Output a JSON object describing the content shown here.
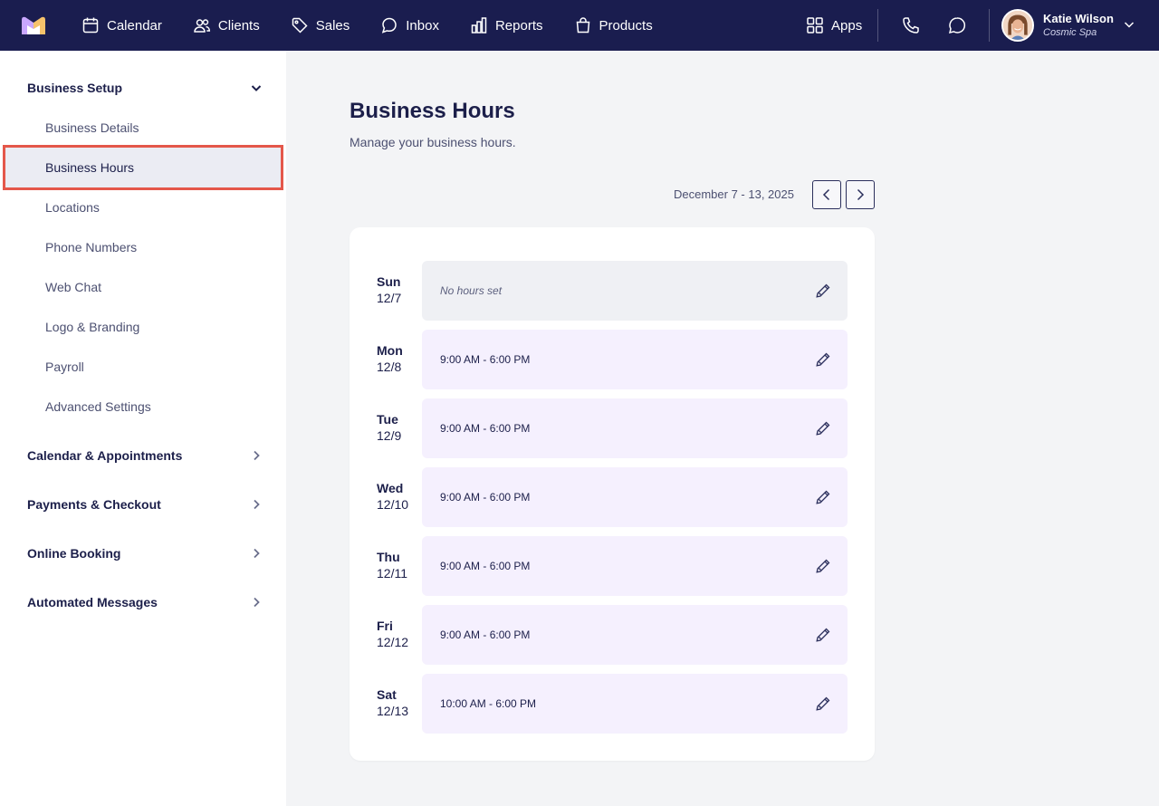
{
  "nav": {
    "items": [
      {
        "label": "Calendar",
        "icon": "calendar-icon"
      },
      {
        "label": "Clients",
        "icon": "clients-icon"
      },
      {
        "label": "Sales",
        "icon": "tag-icon"
      },
      {
        "label": "Inbox",
        "icon": "inbox-icon"
      },
      {
        "label": "Reports",
        "icon": "bar-chart-icon"
      },
      {
        "label": "Products",
        "icon": "shopping-bag-icon"
      }
    ],
    "apps_label": "Apps",
    "user": {
      "name": "Katie Wilson",
      "org": "Cosmic Spa"
    }
  },
  "sidebar": {
    "sections": [
      {
        "label": "Business Setup",
        "expanded": true
      },
      {
        "label": "Calendar & Appointments",
        "expanded": false
      },
      {
        "label": "Payments & Checkout",
        "expanded": false
      },
      {
        "label": "Online Booking",
        "expanded": false
      },
      {
        "label": "Automated Messages",
        "expanded": false
      }
    ],
    "items": [
      {
        "label": "Business Details"
      },
      {
        "label": "Business Hours",
        "active": true
      },
      {
        "label": "Locations"
      },
      {
        "label": "Phone Numbers"
      },
      {
        "label": "Web Chat"
      },
      {
        "label": "Logo & Branding"
      },
      {
        "label": "Payroll"
      },
      {
        "label": "Advanced Settings"
      }
    ]
  },
  "page": {
    "title": "Business Hours",
    "subtitle": "Manage your business hours.",
    "date_range": "December 7 - 13, 2025"
  },
  "days": [
    {
      "name": "Sun",
      "date": "12/7",
      "hours": "No hours set",
      "set": false
    },
    {
      "name": "Mon",
      "date": "12/8",
      "hours": "9:00 AM - 6:00 PM",
      "set": true
    },
    {
      "name": "Tue",
      "date": "12/9",
      "hours": "9:00 AM - 6:00 PM",
      "set": true
    },
    {
      "name": "Wed",
      "date": "12/10",
      "hours": "9:00 AM - 6:00 PM",
      "set": true
    },
    {
      "name": "Thu",
      "date": "12/11",
      "hours": "9:00 AM - 6:00 PM",
      "set": true
    },
    {
      "name": "Fri",
      "date": "12/12",
      "hours": "9:00 AM - 6:00 PM",
      "set": true
    },
    {
      "name": "Sat",
      "date": "12/13",
      "hours": "10:00 AM - 6:00 PM",
      "set": true
    }
  ],
  "colors": {
    "nav_bg": "#1a1d4f",
    "highlight": "#e4574a",
    "hours_bg": "#f5f0fe",
    "empty_bg": "#eff0f4"
  }
}
